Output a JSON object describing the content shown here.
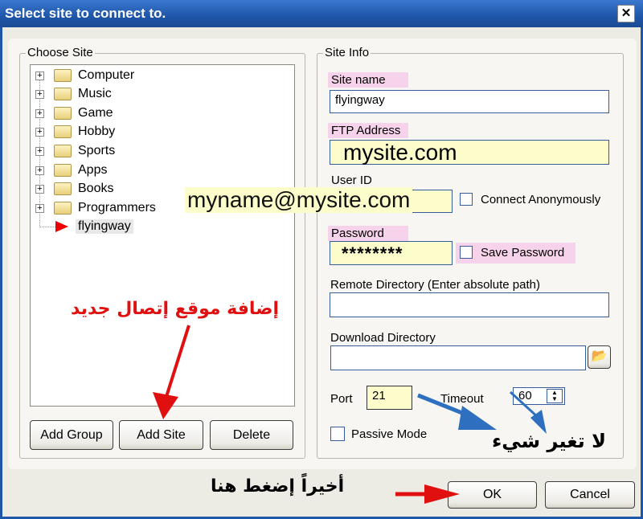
{
  "window": {
    "title": "Select site to connect to.",
    "close_icon": "close-icon"
  },
  "choose_site": {
    "legend": "Choose Site",
    "tree": [
      {
        "label": "Computer"
      },
      {
        "label": "Music"
      },
      {
        "label": "Game"
      },
      {
        "label": "Hobby"
      },
      {
        "label": "Sports"
      },
      {
        "label": "Apps"
      },
      {
        "label": "Books"
      },
      {
        "label": "Programmers"
      },
      {
        "label": "flyingway"
      }
    ],
    "buttons": {
      "add_group": "Add Group",
      "add_site": "Add Site",
      "delete": "Delete"
    }
  },
  "site_info": {
    "legend": "Site Info",
    "site_name_label": "Site name",
    "site_name_value": "flyingway",
    "ftp_label": "FTP Address",
    "ftp_value": "mysite.com",
    "user_label": "User ID",
    "user_value": "myname@mysite.com",
    "anon_label": "Connect Anonymously",
    "password_label": "Password",
    "password_value": "********",
    "save_password_label": "Save Password",
    "remote_dir_label": "Remote Directory (Enter absolute path)",
    "remote_dir_value": "",
    "download_dir_label": "Download Directory",
    "download_dir_value": "",
    "port_label": "Port",
    "port_value": "21",
    "timeout_label": "Timeout",
    "timeout_value": "60",
    "passive_label": "Passive Mode"
  },
  "footer": {
    "ok": "OK",
    "cancel": "Cancel"
  },
  "annotations": {
    "add_site": "إضافة موقع إتصال جديد",
    "no_change": "لا تغير شيء",
    "press_here": "أخيراً إضغط هنا"
  },
  "colors": {
    "titlebar": "#1f56a8",
    "highlight_pink": "#f6d3ea",
    "field_yellow": "#fdfdcc",
    "annotation_red": "#e01010",
    "arrow_blue": "#2f6fc0"
  }
}
